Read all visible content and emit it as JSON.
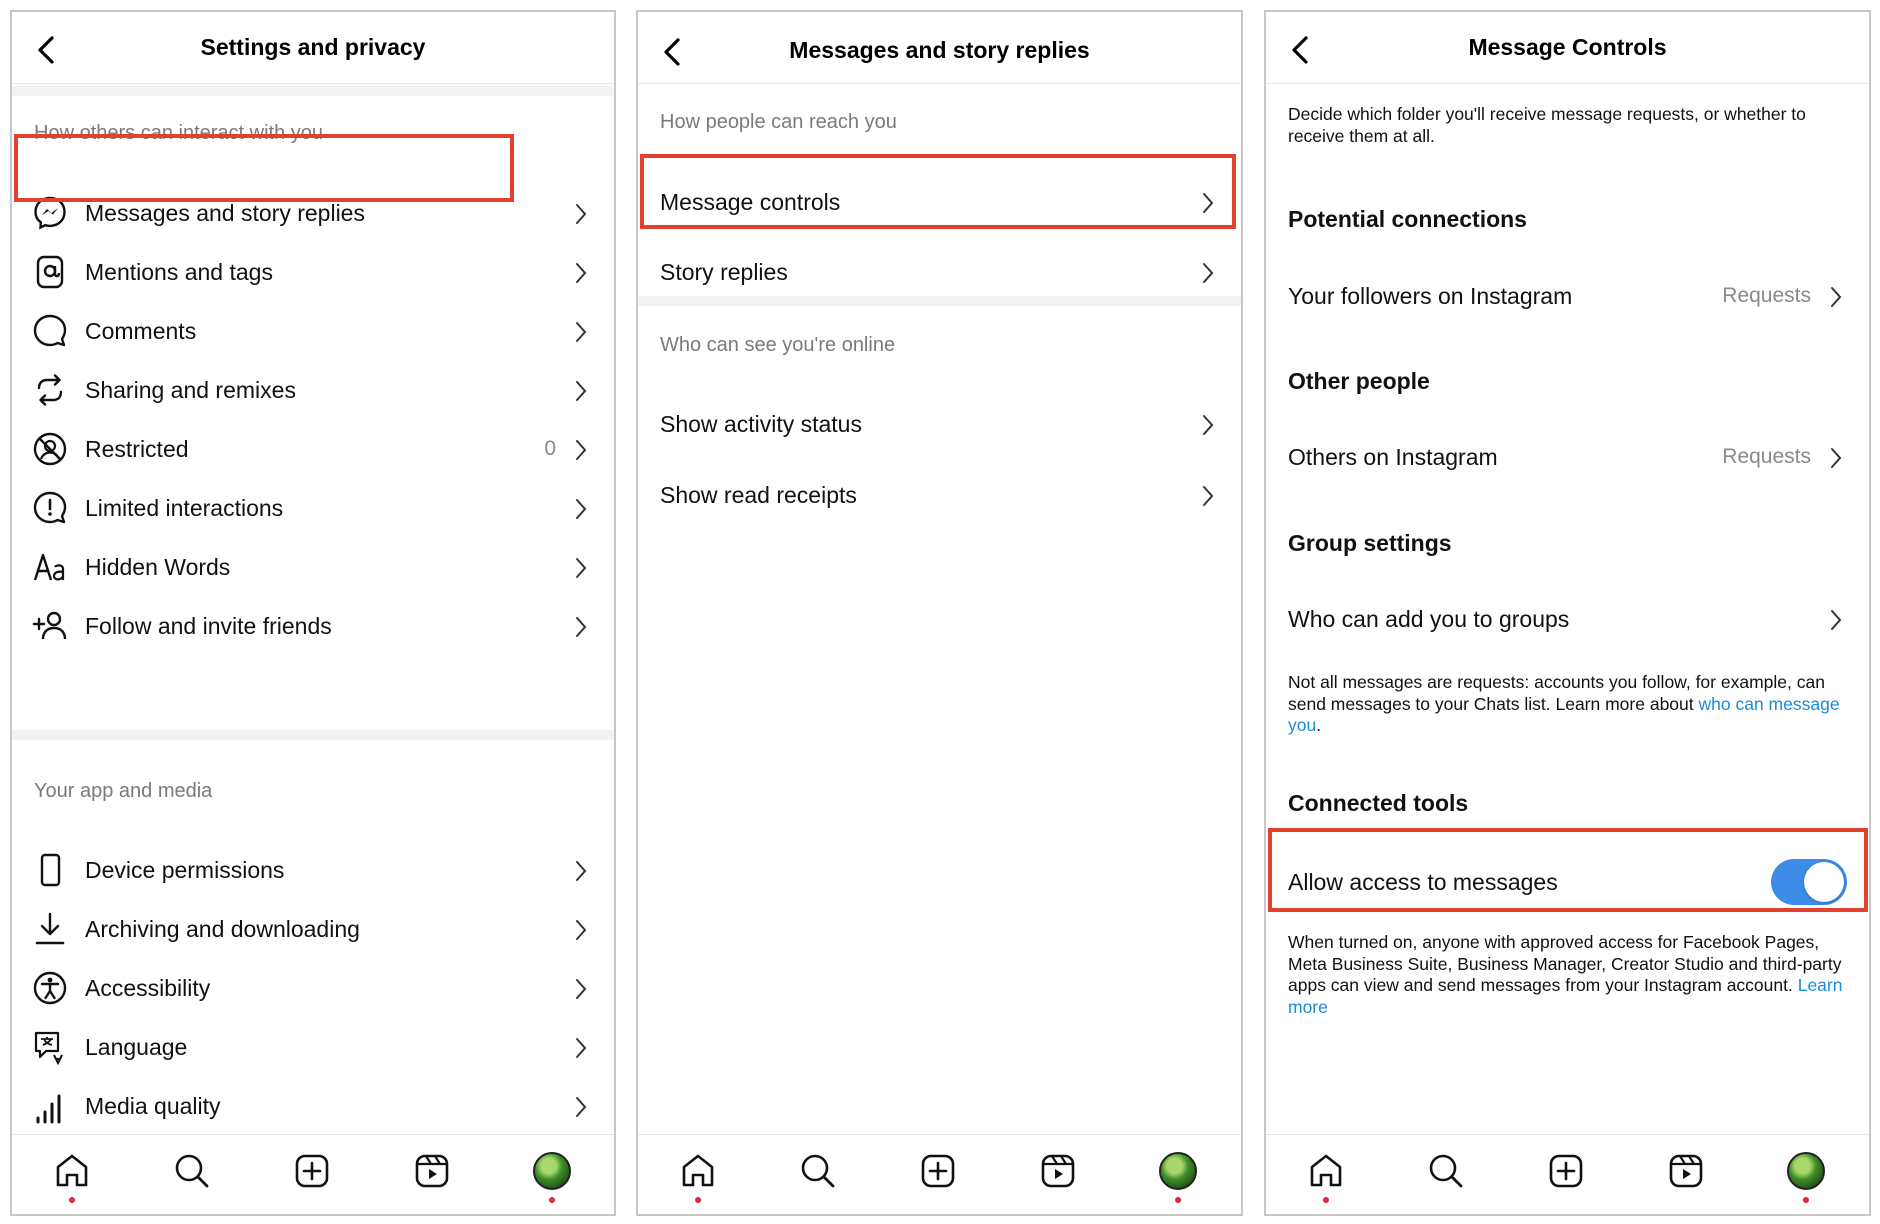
{
  "colors": {
    "highlight": "#e2412e",
    "toggle_on": "#3d8ce8",
    "link": "#1a8cd8",
    "notification_dot": "#e5243b"
  },
  "panel1": {
    "title": "Settings and privacy",
    "section1": "How others can interact with you",
    "items1": [
      {
        "label": "Messages and story replies",
        "icon": "messenger-icon"
      },
      {
        "label": "Mentions and tags",
        "icon": "at-sign-icon"
      },
      {
        "label": "Comments",
        "icon": "comment-icon"
      },
      {
        "label": "Sharing and remixes",
        "icon": "share-remix-icon"
      },
      {
        "label": "Restricted",
        "icon": "restricted-icon",
        "count": "0"
      },
      {
        "label": "Limited interactions",
        "icon": "limited-interactions-icon"
      },
      {
        "label": "Hidden Words",
        "icon": "text-aa-icon"
      },
      {
        "label": "Follow and invite friends",
        "icon": "add-person-icon"
      }
    ],
    "section2": "Your app and media",
    "items2": [
      {
        "label": "Device permissions",
        "icon": "phone-icon"
      },
      {
        "label": "Archiving and downloading",
        "icon": "download-icon"
      },
      {
        "label": "Accessibility",
        "icon": "accessibility-icon"
      },
      {
        "label": "Language",
        "icon": "translate-icon"
      },
      {
        "label": "Media quality",
        "icon": "signal-bars-icon"
      }
    ]
  },
  "panel2": {
    "title": "Messages and story replies",
    "section1": "How people can reach you",
    "items1": [
      {
        "label": "Message controls"
      },
      {
        "label": "Story replies"
      }
    ],
    "section2": "Who can see you're online",
    "items2": [
      {
        "label": "Show activity status"
      },
      {
        "label": "Show read receipts"
      }
    ]
  },
  "panel3": {
    "title": "Message Controls",
    "intro": "Decide which folder you'll receive message requests, or whether to receive them at all.",
    "potential_connections": "Potential connections",
    "followers_label": "Your followers on Instagram",
    "followers_value": "Requests",
    "other_people": "Other people",
    "others_label": "Others on Instagram",
    "others_value": "Requests",
    "group_settings": "Group settings",
    "groups_label": "Who can add you to groups",
    "note_text": "Not all messages are requests: accounts you follow, for example, can send messages to your Chats list. Learn more about ",
    "note_link": "who can message you",
    "note_end": ".",
    "connected_tools": "Connected tools",
    "allow_label": "Allow access to messages",
    "allow_on": true,
    "footer_text": "When turned on, anyone with approved access for Facebook Pages, Meta Business Suite, Business Manager, Creator Studio and third-party apps can view and send messages from your Instagram account. ",
    "footer_link": "Learn more"
  },
  "tabbar": [
    "home-icon",
    "search-icon",
    "create-icon",
    "reels-icon",
    "profile-avatar"
  ]
}
